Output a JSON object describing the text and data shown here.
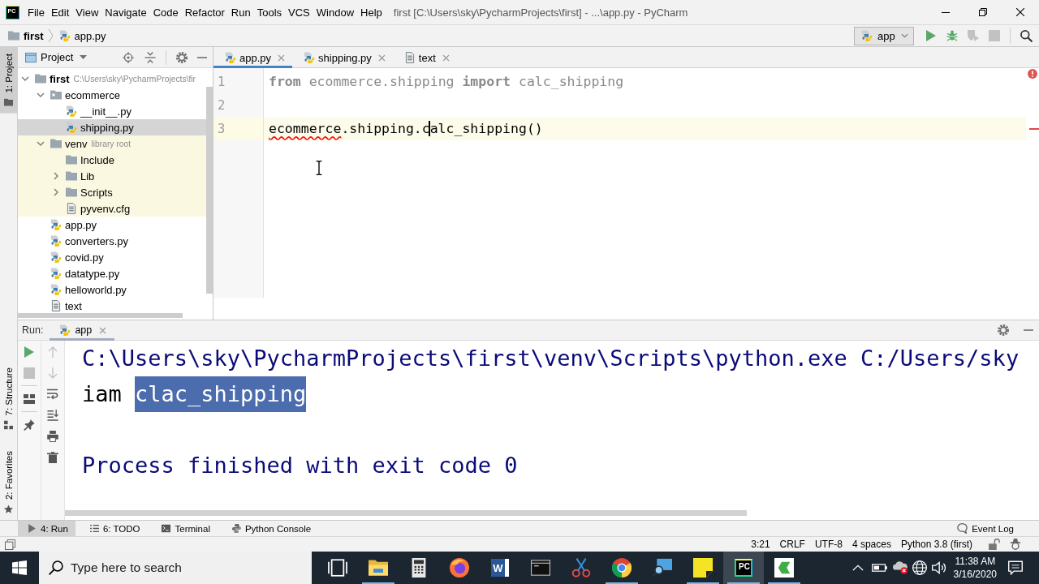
{
  "window": {
    "app_icon": "PC",
    "menu": [
      "File",
      "Edit",
      "View",
      "Navigate",
      "Code",
      "Refactor",
      "Run",
      "Tools",
      "VCS",
      "Window",
      "Help"
    ],
    "title": "first [C:\\Users\\sky\\PycharmProjects\\first] - ...\\app.py - PyCharm"
  },
  "navigation_bar": {
    "breadcrumbs": [
      {
        "label": "first",
        "kind": "folder"
      },
      {
        "label": "app.py",
        "kind": "python"
      }
    ],
    "run_configuration": "app",
    "actions": [
      {
        "kind": "run",
        "disabled": false
      },
      {
        "kind": "debug",
        "disabled": false
      },
      {
        "kind": "coverage",
        "disabled": true
      },
      {
        "kind": "stop",
        "disabled": true
      },
      {
        "kind": "search",
        "disabled": false
      }
    ]
  },
  "tool_strip": {
    "top": [
      {
        "label": "1: Project",
        "kind": "project",
        "selected": true
      }
    ],
    "bottom": [
      {
        "label": "7: Structure",
        "kind": "structure",
        "selected": false
      },
      {
        "label": "2: Favorites",
        "kind": "favorites",
        "selected": false
      }
    ]
  },
  "project_panel": {
    "title": "Project",
    "tree": [
      {
        "name": "first",
        "kind": "folder",
        "hint": "C:\\Users\\sky\\PycharmProjects\\fir",
        "expanded": true,
        "library": false,
        "selected": false,
        "children": [
          {
            "name": "ecommerce",
            "kind": "package",
            "expanded": true,
            "library": false,
            "selected": false,
            "children": [
              {
                "name": "__init__.py",
                "kind": "python",
                "selected": false
              },
              {
                "name": "shipping.py",
                "kind": "python",
                "selected": true
              }
            ]
          },
          {
            "name": "venv",
            "kind": "folder",
            "hint": "library root",
            "expanded": true,
            "library": true,
            "selected": false,
            "children": [
              {
                "name": "Include",
                "kind": "folder",
                "selected": false
              },
              {
                "name": "Lib",
                "kind": "folder",
                "expanded": false,
                "selected": false
              },
              {
                "name": "Scripts",
                "kind": "folder",
                "expanded": false,
                "selected": false
              },
              {
                "name": "pyvenv.cfg",
                "kind": "text",
                "selected": false
              }
            ]
          },
          {
            "name": "app.py",
            "kind": "python",
            "selected": false
          },
          {
            "name": "converters.py",
            "kind": "python",
            "selected": false
          },
          {
            "name": "covid.py",
            "kind": "python",
            "selected": false
          },
          {
            "name": "datatype.py",
            "kind": "python",
            "selected": false
          },
          {
            "name": "helloworld.py",
            "kind": "python",
            "selected": false
          },
          {
            "name": "text",
            "kind": "text",
            "selected": false
          }
        ]
      }
    ]
  },
  "editor": {
    "tabs": [
      {
        "label": "app.py",
        "kind": "python",
        "selected": true
      },
      {
        "label": "shipping.py",
        "kind": "python",
        "selected": false
      },
      {
        "label": "text",
        "kind": "text",
        "selected": false
      }
    ],
    "lines": [
      {
        "number": "1",
        "current": false,
        "unused": true,
        "error": false,
        "tokens": [
          {
            "text": "from",
            "kind": "keyword"
          },
          {
            "text": " ecommerce.shipping ",
            "kind": "plain"
          },
          {
            "text": "import",
            "kind": "keyword"
          },
          {
            "text": " calc_shipping",
            "kind": "plain"
          }
        ]
      },
      {
        "number": "2",
        "current": false,
        "error": false
      },
      {
        "number": "3",
        "current": true,
        "unused": false,
        "error": true,
        "tokens": [
          {
            "text": "ecommerce",
            "kind": "error"
          },
          {
            "text": ".shipping.c",
            "kind": "plain"
          },
          {
            "text": "alc_shipping()",
            "kind": "plain",
            "caret_before": true
          }
        ]
      }
    ]
  },
  "run_panel": {
    "label": "Run:",
    "tabs": [
      {
        "label": "app",
        "selected": true
      }
    ],
    "toolbar": {
      "left_column": [
        {
          "kind": "rerun",
          "disabled": false
        },
        {
          "kind": "stop",
          "disabled": true
        },
        {
          "kind": "layout",
          "disabled": false
        },
        {
          "kind": "pin",
          "disabled": false
        }
      ],
      "right_column": [
        {
          "kind": "up",
          "disabled": true
        },
        {
          "kind": "down",
          "disabled": true
        },
        {
          "kind": "soft_wrap",
          "disabled": false
        },
        {
          "kind": "scroll_to_end",
          "disabled": false
        },
        {
          "kind": "print",
          "disabled": false
        },
        {
          "kind": "clear",
          "disabled": false
        }
      ]
    },
    "console": [
      {
        "kind": "command",
        "segments": [
          {
            "text": "C:\\Users\\sky\\PycharmProjects\\first\\venv\\Scripts\\python.exe C:/Users/sky",
            "selected": false
          }
        ]
      },
      {
        "kind": "output",
        "segments": [
          {
            "text": "iam ",
            "selected": false
          },
          {
            "text": "clac_shipping",
            "selected": true
          }
        ]
      },
      {
        "kind": "exit",
        "segments": [
          {
            "text": "Process finished with exit code 0",
            "selected": false
          }
        ]
      }
    ]
  },
  "tool_window_bar": {
    "buttons": [
      {
        "label": "4: Run",
        "kind": "run",
        "selected": true
      },
      {
        "label": "6: TODO",
        "kind": "todo",
        "selected": false
      },
      {
        "label": "Terminal",
        "kind": "terminal",
        "selected": false
      },
      {
        "label": "Python Console",
        "kind": "console",
        "selected": false
      }
    ],
    "event_log": "Event Log"
  },
  "status_bar": {
    "items": [
      "3:21",
      "CRLF",
      "UTF-8",
      "4 spaces",
      "Python 3.8 (first)"
    ]
  },
  "taskbar": {
    "search_placeholder": "Type here to search",
    "apps": [
      {
        "kind": "task_view",
        "running": false,
        "selected": false
      },
      {
        "kind": "explorer",
        "running": true,
        "selected": false
      },
      {
        "kind": "calculator",
        "running": false,
        "selected": false
      },
      {
        "kind": "firefox",
        "running": false,
        "selected": false
      },
      {
        "kind": "word",
        "label": "W",
        "running": false,
        "selected": false
      },
      {
        "kind": "cmd",
        "running": false,
        "selected": false
      },
      {
        "kind": "snipping",
        "running": false,
        "selected": false
      },
      {
        "kind": "chrome",
        "running": true,
        "selected": false
      },
      {
        "kind": "magnifier",
        "running": false,
        "selected": false
      },
      {
        "kind": "sticky_notes",
        "running": true,
        "selected": false
      },
      {
        "kind": "pycharm",
        "label": "PC",
        "running": true,
        "selected": true
      },
      {
        "kind": "camtasia",
        "running": true,
        "selected": false
      }
    ],
    "time": "11:38 AM",
    "date": "3/16/2020"
  }
}
